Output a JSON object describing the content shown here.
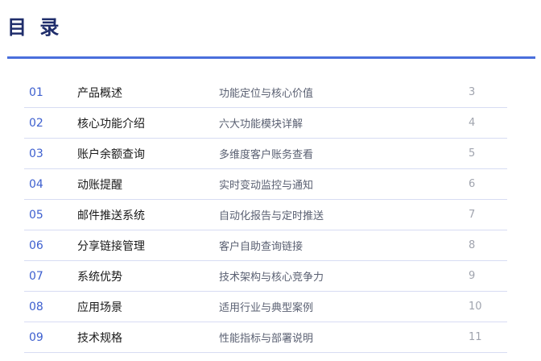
{
  "title": "目 录",
  "toc": [
    {
      "num": "01",
      "name": "产品概述",
      "desc": "功能定位与核心价值",
      "page": "3"
    },
    {
      "num": "02",
      "name": "核心功能介绍",
      "desc": "六大功能模块详解",
      "page": "4"
    },
    {
      "num": "03",
      "name": "账户余额查询",
      "desc": "多维度客户账务查看",
      "page": "5"
    },
    {
      "num": "04",
      "name": "动账提醒",
      "desc": "实时变动监控与通知",
      "page": "6"
    },
    {
      "num": "05",
      "name": "邮件推送系统",
      "desc": "自动化报告与定时推送",
      "page": "7"
    },
    {
      "num": "06",
      "name": "分享链接管理",
      "desc": "客户自助查询链接",
      "page": "8"
    },
    {
      "num": "07",
      "name": "系统优势",
      "desc": "技术架构与核心竞争力",
      "page": "9"
    },
    {
      "num": "08",
      "name": "应用场景",
      "desc": "适用行业与典型案例",
      "page": "10"
    },
    {
      "num": "09",
      "name": "技术规格",
      "desc": "性能指标与部署说明",
      "page": "11"
    }
  ],
  "colors": {
    "title": "#1f2d6b",
    "accent": "#4a6fdc",
    "number": "#3d5fcf",
    "divider": "#d7dcf3"
  }
}
